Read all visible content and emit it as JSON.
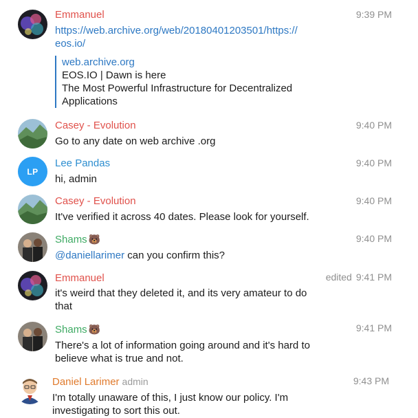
{
  "messages": [
    {
      "sender": "Emmanuel",
      "time": "9:39 PM",
      "link_line1": "https://web.archive.org/web/20180401203501/https://",
      "link_line2": "eos.io/",
      "preview": {
        "site": "web.archive.org",
        "title": "EOS.IO | Dawn is here",
        "desc_line1": "The Most Powerful Infrastructure for Decentralized",
        "desc_line2": "Applications"
      }
    },
    {
      "sender": "Casey - Evolution",
      "time": "9:40 PM",
      "text": "Go to any date on web archive .org"
    },
    {
      "sender": "Lee Pandas",
      "avatar_initials": "LP",
      "time": "9:40 PM",
      "text": "hi, admin"
    },
    {
      "sender": "Casey - Evolution",
      "time": "9:40 PM",
      "text": "It've verified it across 40 dates. Please look for yourself."
    },
    {
      "sender": "Shams",
      "emoji": "🐻",
      "time": "9:40 PM",
      "mention": "@daniellarimer",
      "text": " can you confirm this?"
    },
    {
      "sender": "Emmanuel",
      "edited": "edited",
      "time": "9:41 PM",
      "text_line1": "it's weird that they deleted it, and its very amateur to do",
      "text_line2": "that"
    },
    {
      "sender": "Shams",
      "emoji": "🐻",
      "time": "9:41 PM",
      "text_line1": "There's a lot of information going around and it's hard to",
      "text_line2": "believe what is true and not."
    },
    {
      "sender": "Daniel Larimer",
      "role": "admin",
      "time": "9:43 PM",
      "text_line1": "I'm totally unaware of this, I just know our policy.  I'm",
      "text_line2": "investigating to sort this out."
    }
  ],
  "colors": {
    "red_name": "#e0514b",
    "blue_name": "#2d8ed0",
    "green_name": "#3eaa63",
    "orange_name": "#e07a2c",
    "link": "#2d78c3",
    "avatar_lp": "#2b9ff3"
  }
}
